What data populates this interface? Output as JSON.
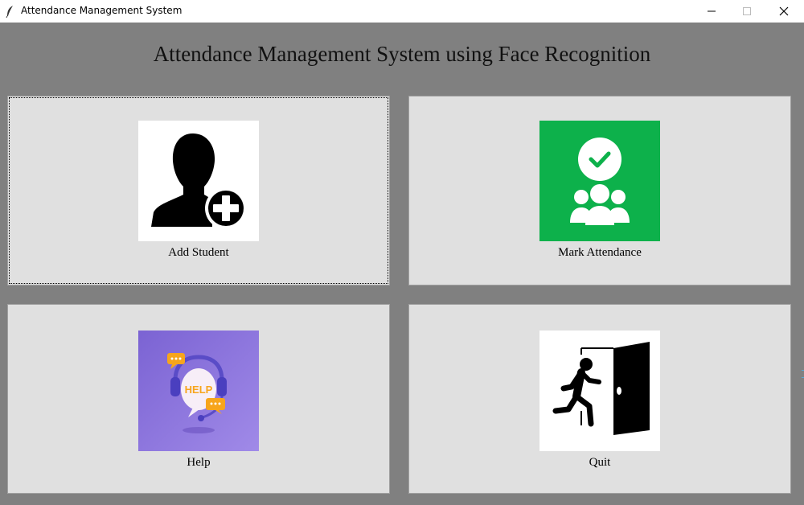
{
  "window": {
    "title": "Attendance Management System",
    "minimize_icon": "minimize-icon",
    "maximize_icon": "maximize-icon",
    "close_icon": "close-icon"
  },
  "main": {
    "title": "Attendance Management System using Face Recognition"
  },
  "tiles": [
    {
      "label": "Add Student",
      "icon": "add-user-icon"
    },
    {
      "label": "Mark Attendance",
      "icon": "group-check-icon"
    },
    {
      "label": "Help",
      "icon": "help-headset-icon"
    },
    {
      "label": "Quit",
      "icon": "exit-door-icon"
    }
  ],
  "colors": {
    "background": "#808080",
    "tile": "#e0e0e0",
    "attendance_green": "#0db14b",
    "help_purple": "#8a6fd6",
    "help_orange": "#f7a51c"
  }
}
